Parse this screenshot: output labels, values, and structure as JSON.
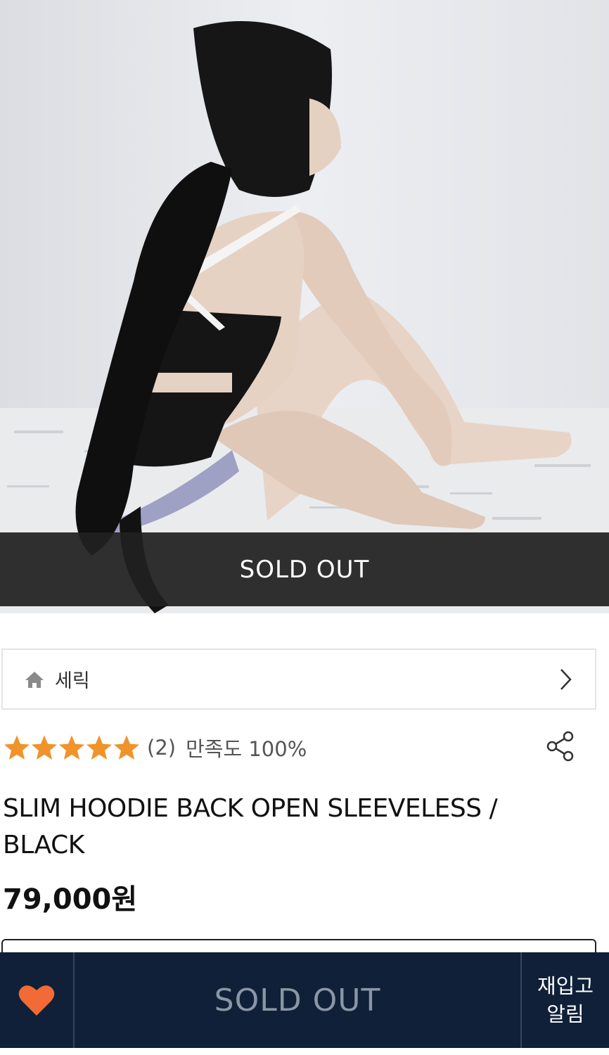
{
  "product_image": {
    "overlay_label": "SOLD OUT"
  },
  "brand": {
    "icon": "home-icon",
    "name": "세릭"
  },
  "rating": {
    "stars": 5,
    "count": "(2)",
    "satisfaction": "만족도 100%",
    "star_color": "#f0932b"
  },
  "product": {
    "title": "SLIM HOODIE BACK OPEN SLEEVELESS / BLACK",
    "price": "79,000원"
  },
  "bottom_bar": {
    "wishlist_icon": "heart-icon",
    "sold_out_label": "SOLD OUT",
    "restock_label_line1": "재입고",
    "restock_label_line2": "알림",
    "background": "#0f2038",
    "heart_color": "#f26a35"
  }
}
